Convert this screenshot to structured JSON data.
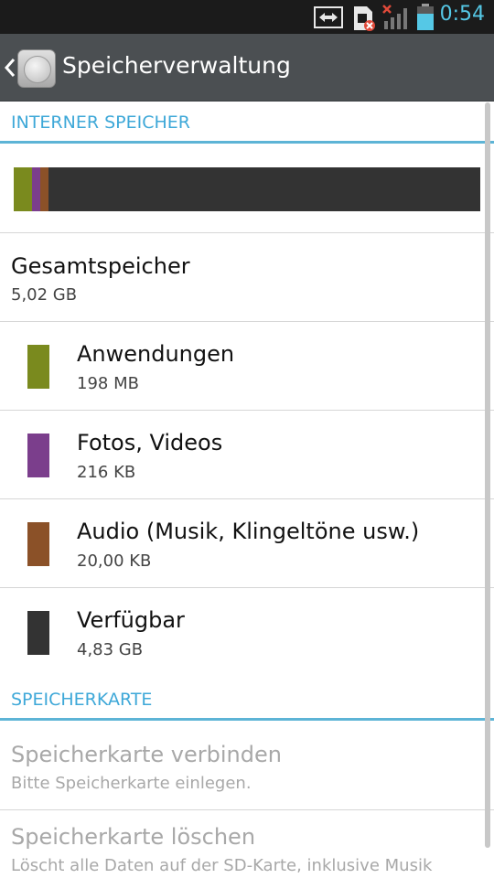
{
  "status_bar": {
    "time": "0:54",
    "icons": [
      "screen-mirror-icon",
      "sim-error-icon",
      "no-signal-icon",
      "battery-icon"
    ]
  },
  "action_bar": {
    "title": "Speicherverwaltung",
    "icon": "storage-icon"
  },
  "internal": {
    "header": "INTERNER SPEICHER",
    "usage": [
      {
        "name": "Anwendungen",
        "color": "#7a8a1e"
      },
      {
        "name": "Fotos, Videos",
        "color": "#7b3e8c"
      },
      {
        "name": "Audio",
        "color": "#8b5128"
      },
      {
        "name": "Verfügbar",
        "color": "#333333"
      }
    ],
    "total": {
      "title": "Gesamtspeicher",
      "value": "5,02 GB"
    },
    "items": [
      {
        "title": "Anwendungen",
        "value": "198 MB",
        "color": "#7a8a1e"
      },
      {
        "title": "Fotos, Videos",
        "value": "216 KB",
        "color": "#7b3e8c"
      },
      {
        "title": "Audio (Musik, Klingeltöne usw.)",
        "value": "20,00 KB",
        "color": "#8b5128"
      },
      {
        "title": "Verfügbar",
        "value": "4,83 GB",
        "color": "#333333"
      }
    ]
  },
  "sdcard": {
    "header": "SPEICHERKARTE",
    "mount": {
      "title": "Speicherkarte verbinden",
      "subtitle": "Bitte Speicherkarte einlegen."
    },
    "erase": {
      "title": "Speicherkarte löschen",
      "subtitle": "Löscht alle Daten auf der SD-Karte, inklusive Musik"
    }
  }
}
